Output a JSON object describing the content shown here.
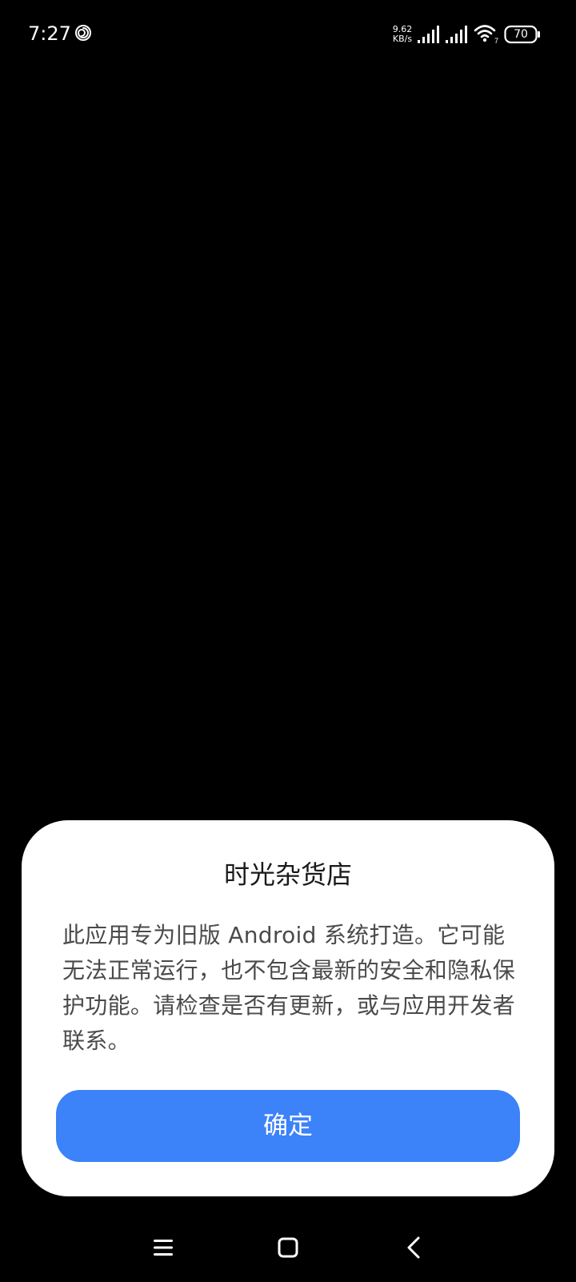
{
  "status_bar": {
    "time": "7:27",
    "net_speed_value": "9.62",
    "net_speed_unit": "KB/s",
    "wifi_label": "7",
    "battery_level": "70",
    "icons": [
      "app-notification-icon",
      "cell-signal-icon",
      "cell-signal-icon",
      "wifi-icon",
      "battery-icon"
    ]
  },
  "dialog": {
    "title": "时光杂货店",
    "message": "此应用专为旧版 Android 系统打造。它可能无法正常运行，也不包含最新的安全和隐私保护功能。请检查是否有更新，或与应用开发者联系。",
    "confirm_label": "确定",
    "accent_color": "#3c82f8"
  },
  "nav_bar": {
    "icons": [
      "menu-icon",
      "home-icon",
      "back-icon"
    ]
  }
}
